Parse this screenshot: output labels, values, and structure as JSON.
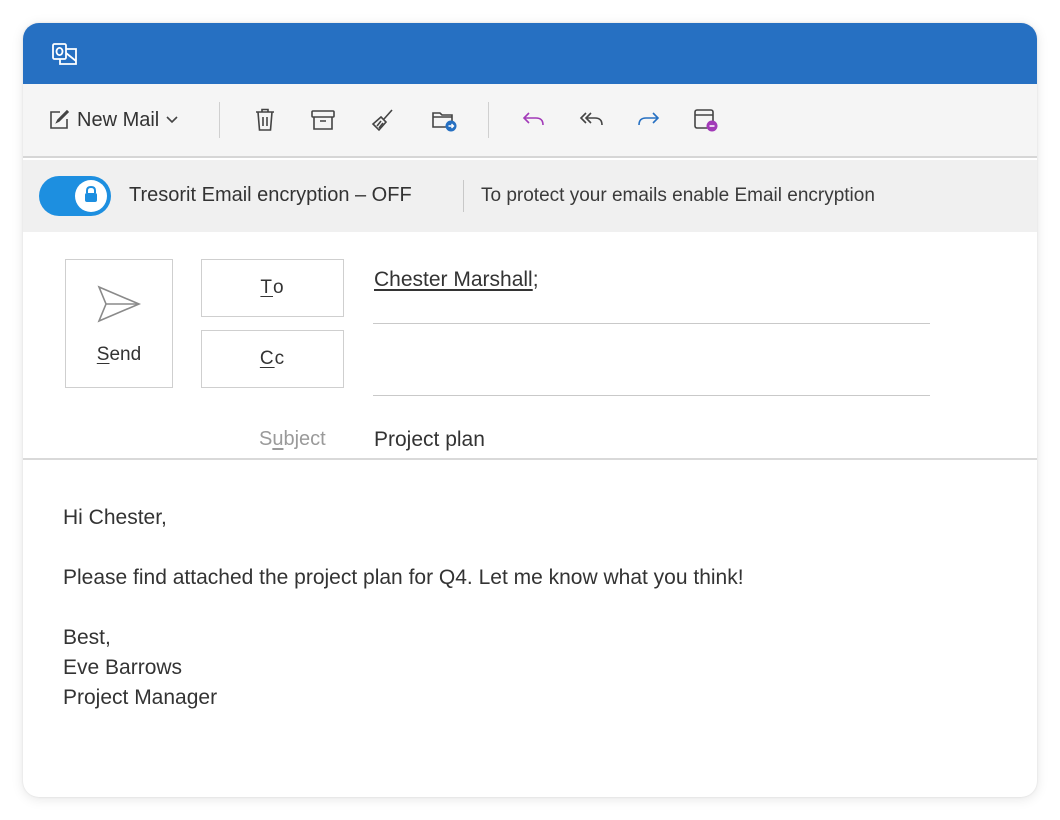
{
  "colors": {
    "titlebar": "#2670c2",
    "toggle_on": "#1d8fe0",
    "reply_icon": "#a23ab8",
    "forward_icon": "#2670c2"
  },
  "titlebar": {
    "icon": "outlook-icon"
  },
  "toolbar": {
    "new_mail_label": "New Mail",
    "icons": [
      "compose-icon",
      "chevron-down-icon",
      "delete-icon",
      "archive-icon",
      "sweep-icon",
      "move-to-folder-icon",
      "reply-icon",
      "reply-all-icon",
      "forward-icon",
      "report-icon"
    ]
  },
  "encryption": {
    "toggle_on": true,
    "status": "Tresorit Email encryption – OFF",
    "hint": "To protect your emails enable Email encryption"
  },
  "compose": {
    "send": {
      "access_key": "S",
      "label_rest": "end"
    },
    "to_button": {
      "access_key": "T",
      "label_rest": "o"
    },
    "cc_button": {
      "access_key": "C",
      "label_rest": "c"
    },
    "to_recipient": "Chester Marshall",
    "to_suffix": ";",
    "cc_value": "",
    "subject_label": {
      "before": "S",
      "access_key": "u",
      "after": "bject"
    },
    "subject_value": "Project plan"
  },
  "message": {
    "greeting": "Hi Chester,",
    "paragraph": "Please find attached the project plan for Q4. Let me know what you think!",
    "closing": "Best,",
    "sender_name": "Eve Barrows",
    "sender_title": "Project Manager"
  }
}
